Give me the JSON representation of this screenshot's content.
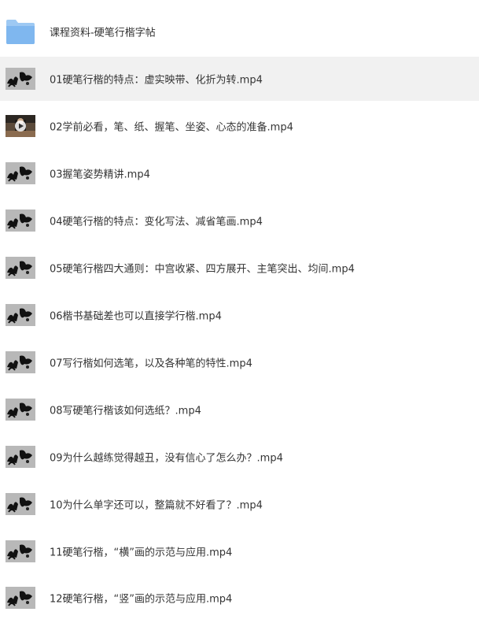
{
  "folder": {
    "name": "课程资料-硬笔行楷字帖",
    "icon": "folder-icon",
    "color": "#7fb7ef"
  },
  "files": [
    {
      "name": "01硬笔行楷的特点：虚实映带、化折为转.mp4",
      "icon": "video-thumbnail-icon",
      "highlighted": true
    },
    {
      "name": "02学前必看，笔、纸、握笔、坐姿、心态的准备.mp4",
      "icon": "video-play-thumbnail-icon"
    },
    {
      "name": "03握笔姿势精讲.mp4",
      "icon": "video-thumbnail-icon"
    },
    {
      "name": "04硬笔行楷的特点：变化写法、减省笔画.mp4",
      "icon": "video-thumbnail-icon"
    },
    {
      "name": "05硬笔行楷四大通则：中宫收紧、四方展开、主笔突出、均间.mp4",
      "icon": "video-thumbnail-icon"
    },
    {
      "name": "06楷书基础差也可以直接学行楷.mp4",
      "icon": "video-thumbnail-icon"
    },
    {
      "name": "07写行楷如何选笔，以及各种笔的特性.mp4",
      "icon": "video-thumbnail-icon"
    },
    {
      "name": "08写硬笔行楷该如何选纸？.mp4",
      "icon": "video-thumbnail-icon"
    },
    {
      "name": "09为什么越练觉得越丑，没有信心了怎么办？.mp4",
      "icon": "video-thumbnail-icon"
    },
    {
      "name": "10为什么单字还可以，整篇就不好看了？.mp4",
      "icon": "video-thumbnail-icon"
    },
    {
      "name": "11硬笔行楷，“横”画的示范与应用.mp4",
      "icon": "video-thumbnail-icon"
    },
    {
      "name": "12硬笔行楷，“竖”画的示范与应用.mp4",
      "icon": "video-thumbnail-icon"
    }
  ],
  "colors": {
    "text": "#333333",
    "highlight_row": "#f1f1f1"
  }
}
